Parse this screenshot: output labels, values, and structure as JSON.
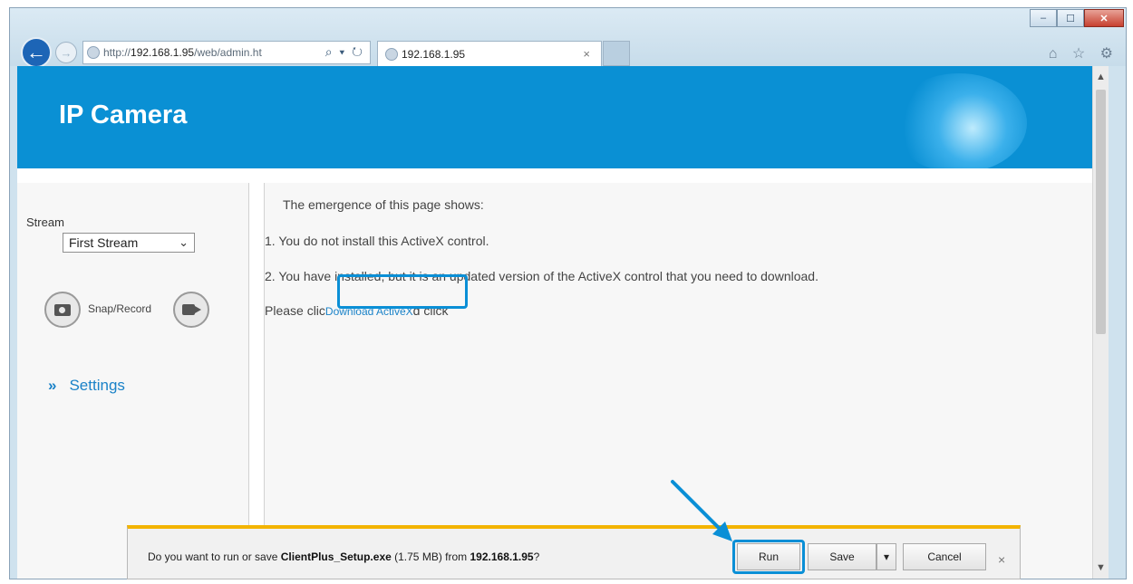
{
  "browser": {
    "address_prefix": "http://",
    "address_host": "192.168.1.95",
    "address_path": "/web/admin.ht",
    "address_tools": "⌕ ▾ ↻",
    "tab_title": "192.168.1.95",
    "tab_close": "×",
    "back_glyph": "←",
    "forward_glyph": "→",
    "top_icons": "⌂ ☆ ⚙",
    "window_controls": [
      "–",
      "☐",
      "✕"
    ]
  },
  "header": {
    "title": "IP Camera"
  },
  "sidebar": {
    "stream_label": "Stream",
    "stream_value": "First Stream",
    "snap_label": "Snap/Record",
    "settings_arrows": "»",
    "settings_label": "Settings"
  },
  "content": {
    "line1": "The emergence of this page shows:",
    "line2": "1. You do not install this ActiveX control.",
    "line3": "2. You have installed, but it is an updated version of the ActiveX control that you need to download.",
    "line4_prefix": "Please clic",
    "link_text": "Download ActiveX",
    "line4_suffix": "d click"
  },
  "download_bar": {
    "text_prefix": "Do you want to run or save ",
    "filename": "ClientPlus_Setup.exe",
    "size": " (1.75 MB) from ",
    "host": "192.168.1.95",
    "text_suffix": "?",
    "run_label": "Run",
    "save_label": "Save",
    "save_menu_glyph": "▾",
    "cancel_label": "Cancel",
    "close_glyph": "×"
  },
  "colors": {
    "header_bg": "#0a90d4",
    "link": "#1a82c8",
    "highlight": "#0a8fd6",
    "notification_accent": "#f3b400"
  },
  "icons": [
    "back-arrow-icon",
    "forward-arrow-icon",
    "search-icon",
    "refresh-icon",
    "home-icon",
    "star-icon",
    "gear-icon",
    "camera-icon",
    "video-icon",
    "chevron-down-icon",
    "close-icon"
  ]
}
